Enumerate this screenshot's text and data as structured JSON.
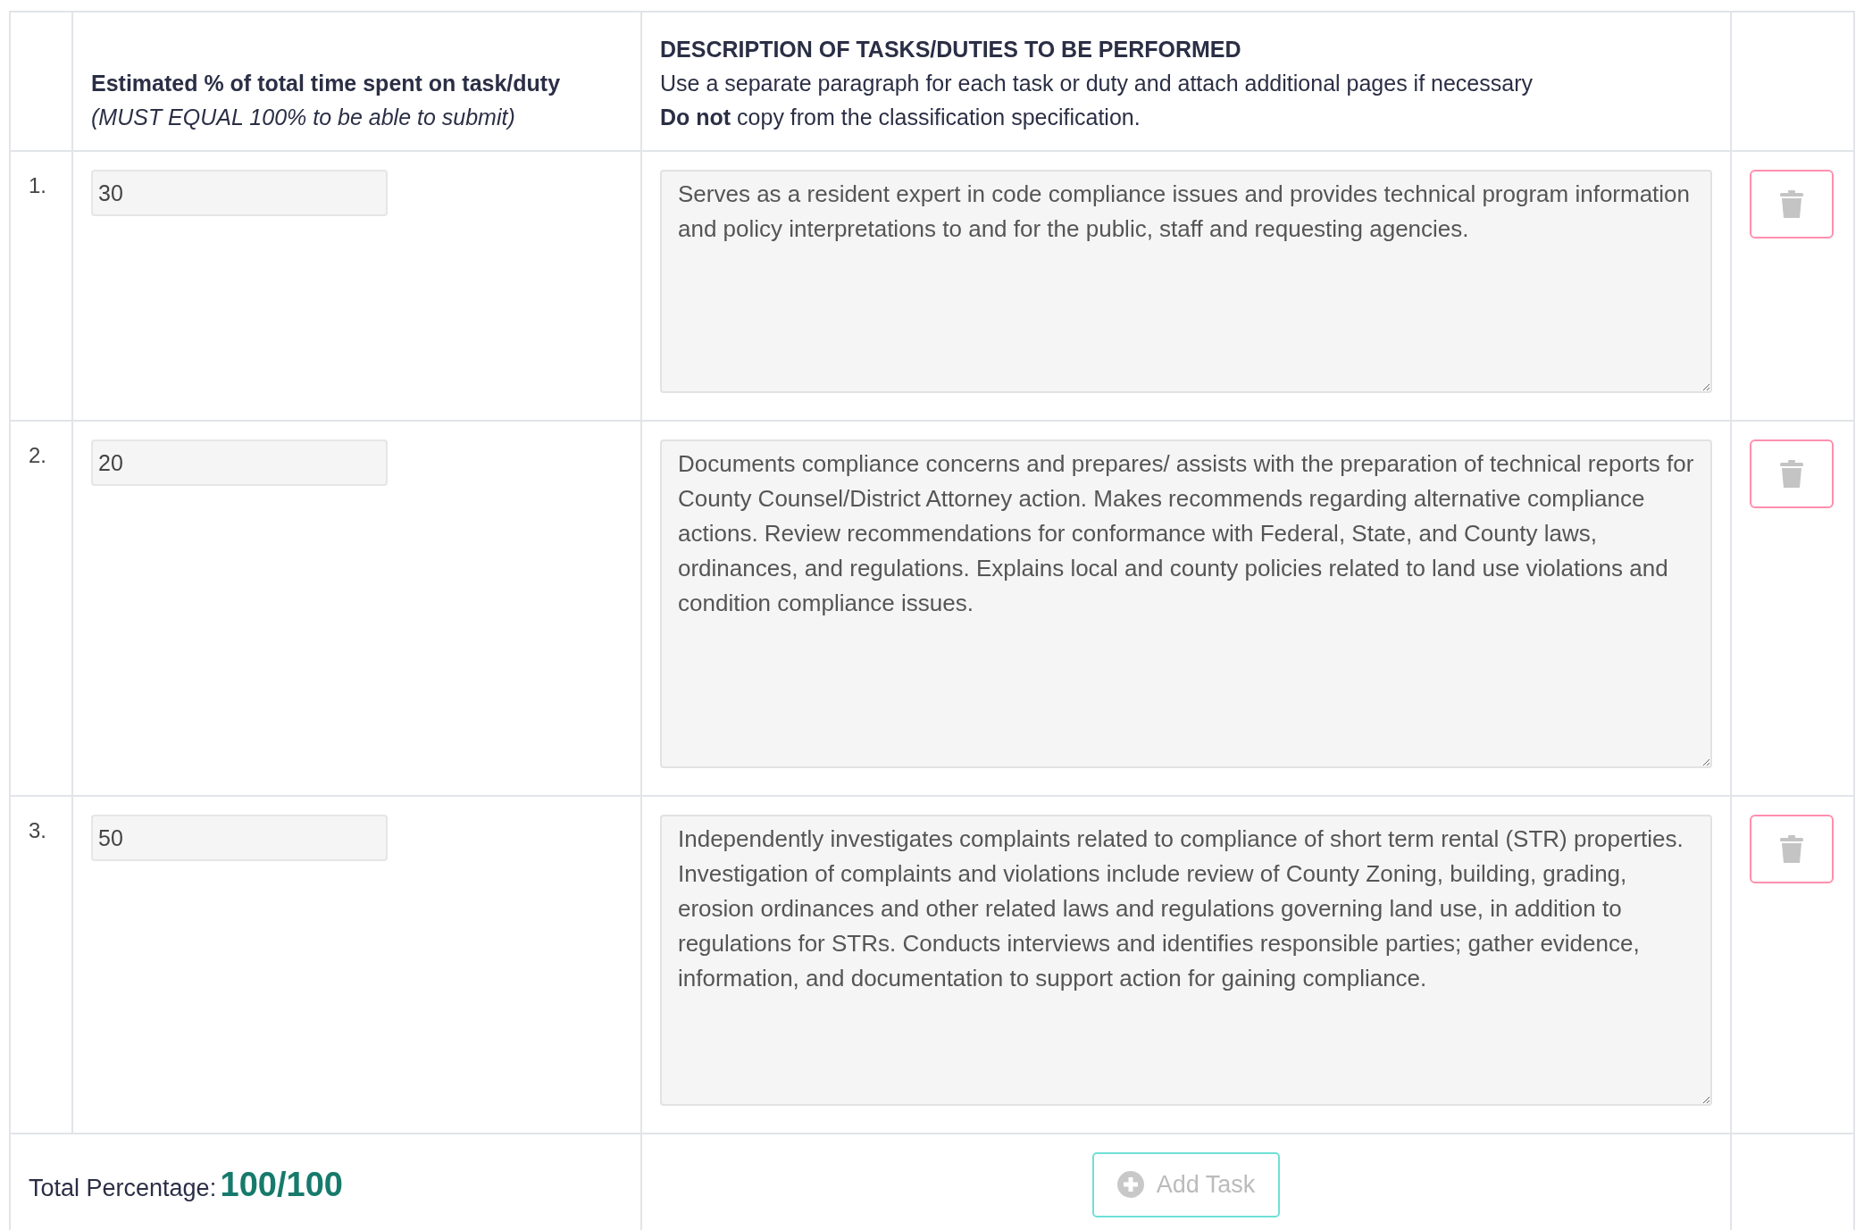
{
  "header": {
    "percent_title": "Estimated % of total time spent on task/duty",
    "percent_note": "(MUST EQUAL 100% to be able to submit)",
    "description_title": "DESCRIPTION OF TASKS/DUTIES TO BE PERFORMED",
    "description_lines": [
      "Use a separate paragraph for each task or duty and attach additional pages if necessary",
      "**Do not** copy from the classification specification."
    ]
  },
  "tasks": [
    {
      "number": "1.",
      "percent": "30",
      "description": "Serves as a resident expert in code compliance issues and provides technical program information and policy interpretations to and for the public, staff and requesting agencies."
    },
    {
      "number": "2.",
      "percent": "20",
      "description": "Documents compliance concerns and prepares/ assists with the preparation of technical reports for County Counsel/District Attorney action. Makes recommends regarding alternative compliance actions. Review recommendations for conformance with Federal, State, and County laws, ordinances, and regulations. Explains local and county policies related to land use violations and condition compliance issues."
    },
    {
      "number": "3.",
      "percent": "50",
      "description": "Independently investigates complaints related to compliance of short term rental (STR) properties. Investigation of complaints and violations include review of County Zoning, building, grading, erosion ordinances and other related laws and regulations governing land use, in addition to regulations for STRs. Conducts interviews and identifies responsible parties; gather evidence, information, and documentation to support action for gaining compliance."
    }
  ],
  "footer": {
    "total_label": "Total Percentage:",
    "total_value": "100/100",
    "add_button": {
      "label": "Add Task",
      "disabled": true
    }
  }
}
